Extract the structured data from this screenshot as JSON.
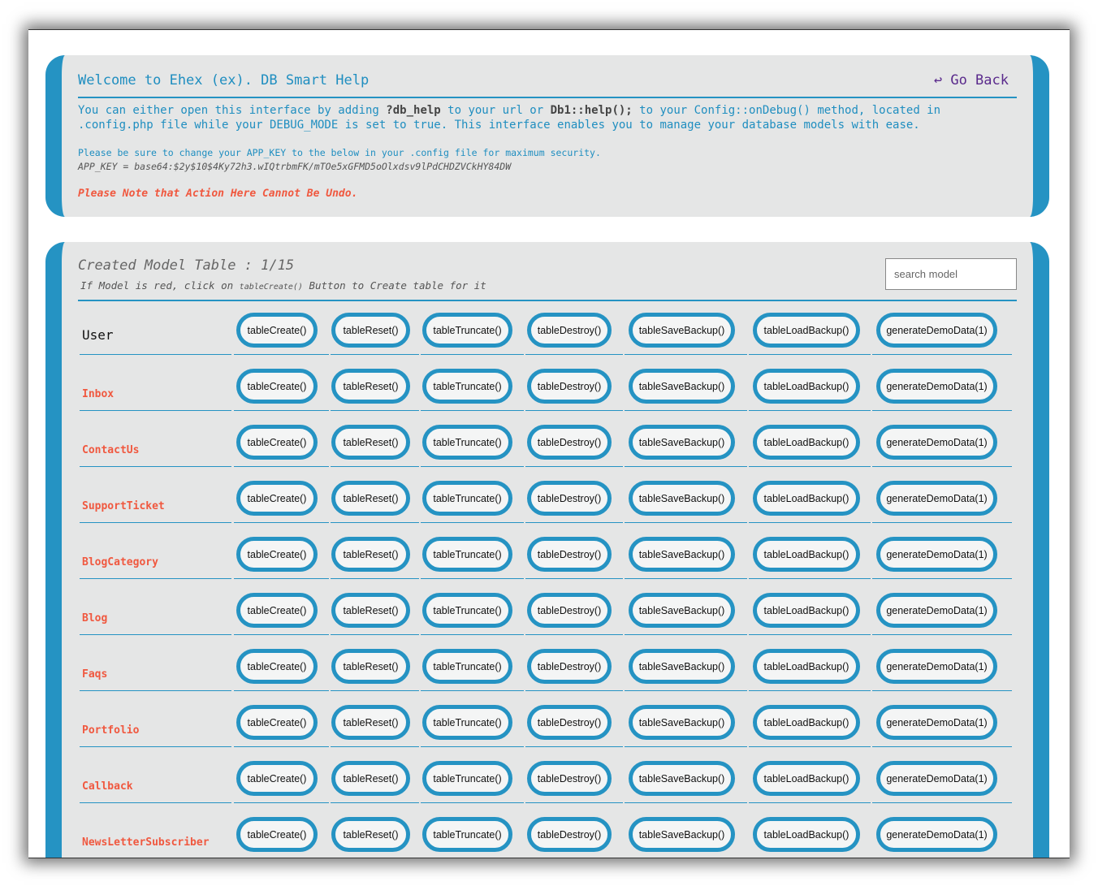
{
  "header": {
    "title": "Welcome to Ehex (ex). DB Smart Help",
    "go_back": "↩ Go Back"
  },
  "intro": {
    "part1": "You can either open this interface by adding ",
    "code1": "?db_help",
    "part2": " to your url or ",
    "code2": "Db1::help();",
    "part3": " to your Config::onDebug() method, located in .config.php file while your DEBUG_MODE is set to true. This interface enables you to manage your database models with ease."
  },
  "appkey_note": "Please be sure to change your APP_KEY to the below in your .config file for maximum security.",
  "appkey_value": "APP_KEY = base64:$2y$10$4Ky72h3.wIQtrbmFK/mTOe5xGFMD5oOlxdsv9lPdCHDZVCkHY84DW",
  "warning": "Please Note that Action Here Cannot Be Undo.",
  "models": {
    "title": "Created Model Table : 1/15",
    "subtitle_pre": "If Model is red, click on ",
    "subtitle_code": "tableCreate()",
    "subtitle_post": " Button to Create table for it",
    "search_placeholder": "search model",
    "actions": [
      "tableCreate()",
      "tableReset()",
      "tableTruncate()",
      "tableDestroy()",
      "tableSaveBackup()",
      "tableLoadBackup()",
      "generateDemoData(1)"
    ],
    "rows": [
      {
        "name": "User",
        "created": true
      },
      {
        "name": "Inbox",
        "created": false
      },
      {
        "name": "ContactUs",
        "created": false
      },
      {
        "name": "SupportTicket",
        "created": false
      },
      {
        "name": "BlogCategory",
        "created": false
      },
      {
        "name": "Blog",
        "created": false
      },
      {
        "name": "Faqs",
        "created": false
      },
      {
        "name": "Portfolio",
        "created": false
      },
      {
        "name": "Callback",
        "created": false
      },
      {
        "name": "NewsLetterSubscriber",
        "created": false
      }
    ]
  },
  "colors": {
    "accent": "#2593c3",
    "panel_bg": "#e5e6e6",
    "warning": "#f0583f",
    "link": "#5a2a8c"
  }
}
